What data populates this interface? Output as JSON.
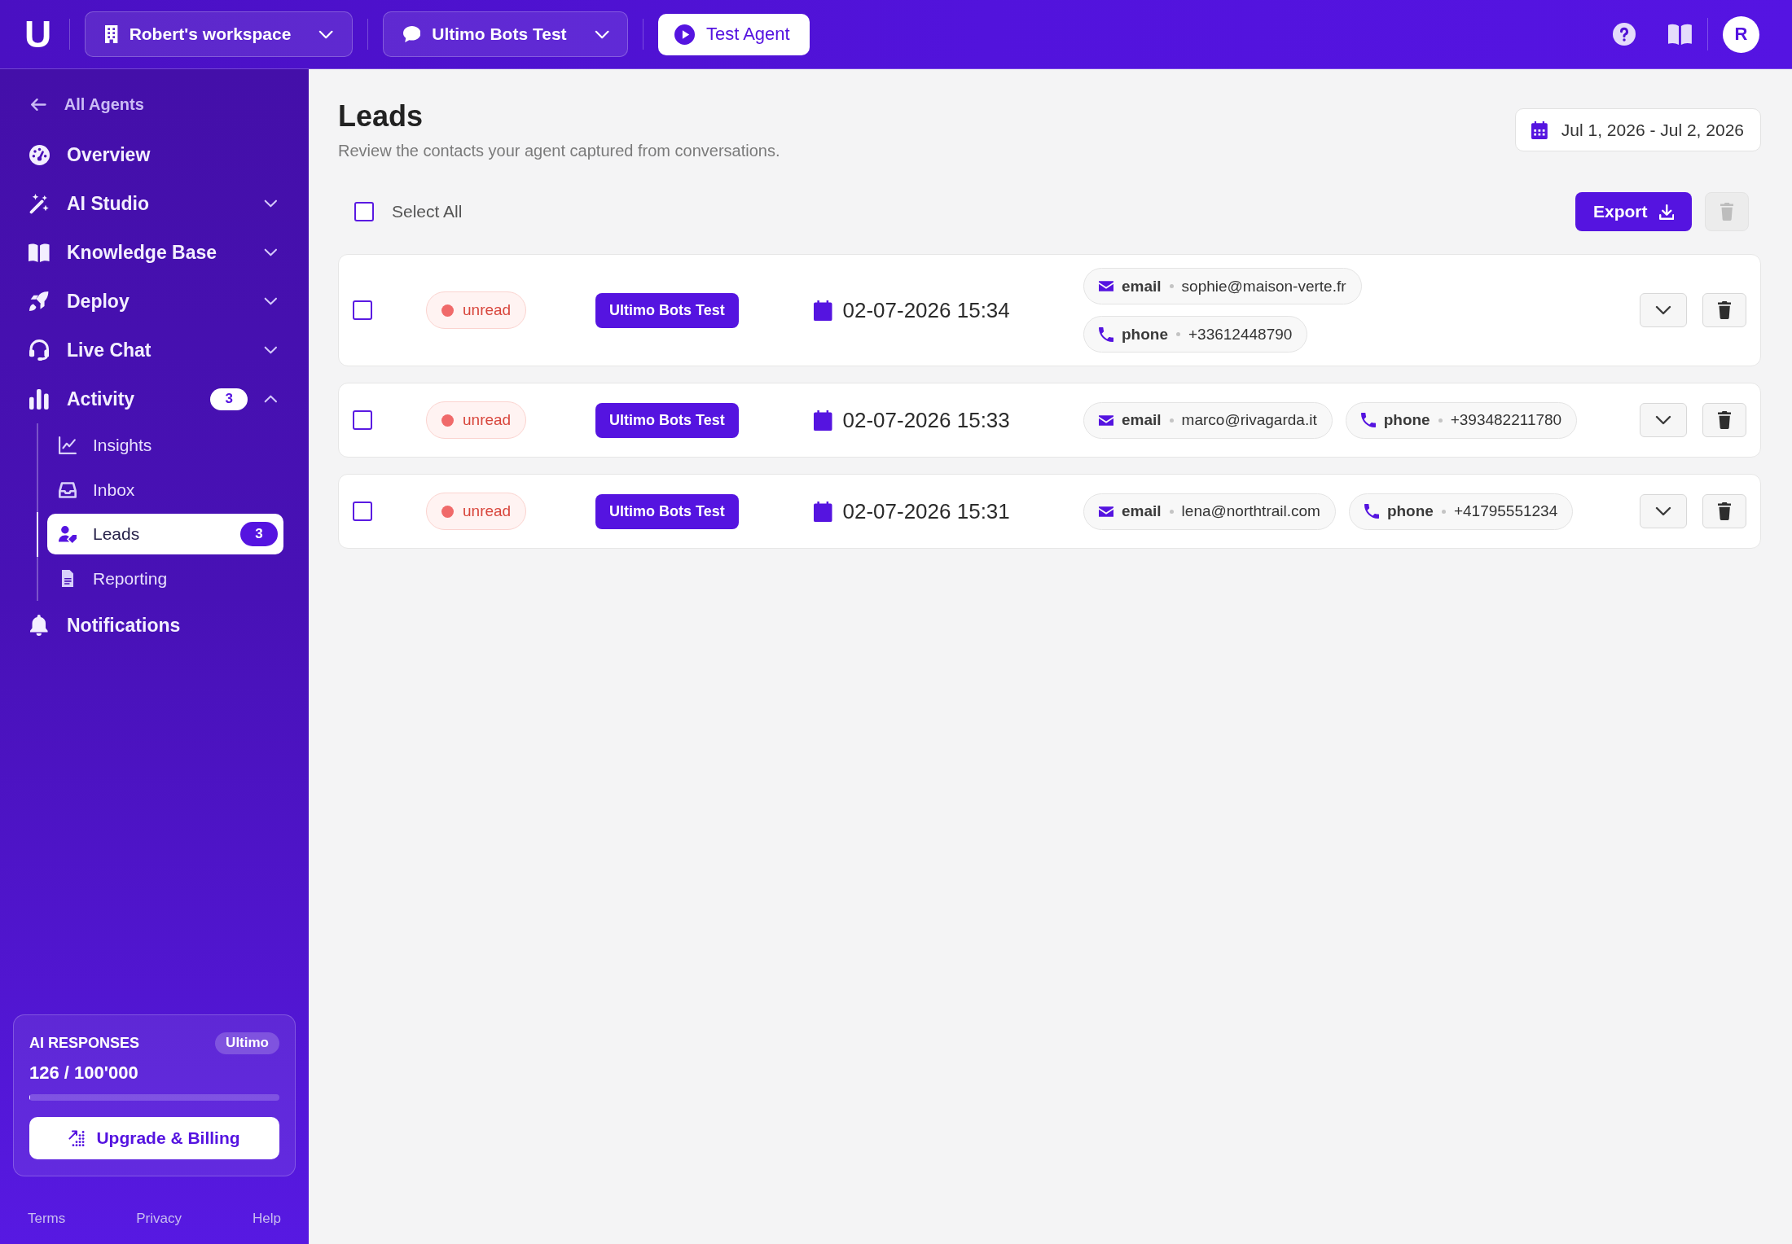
{
  "top_bar": {
    "logo": "U",
    "workspace": "Robert's workspace",
    "agent": "Ultimo Bots Test",
    "test_button": "Test Agent",
    "avatar": "R"
  },
  "sidebar": {
    "back_link": "All Agents",
    "items": [
      {
        "label": "Overview",
        "kind": "link",
        "selected": false
      },
      {
        "label": "AI Studio",
        "kind": "group",
        "expanded": false,
        "selected": false
      },
      {
        "label": "Knowledge Base",
        "kind": "group",
        "expanded": false,
        "selected": false
      },
      {
        "label": "Deploy",
        "kind": "group",
        "expanded": false,
        "selected": false
      },
      {
        "label": "Live Chat",
        "kind": "group",
        "expanded": false,
        "selected": false
      },
      {
        "label": "Activity",
        "kind": "group",
        "expanded": true,
        "selected": false,
        "badge": "3",
        "children": [
          {
            "label": "Insights",
            "selected": false
          },
          {
            "label": "Inbox",
            "selected": false
          },
          {
            "label": "Leads",
            "selected": true,
            "badge": "3"
          },
          {
            "label": "Reporting",
            "selected": false
          }
        ]
      },
      {
        "label": "Notifications",
        "kind": "link",
        "selected": false
      }
    ],
    "usage_card": {
      "title": "AI RESPONSES",
      "plan": "Ultimo",
      "count": "126 / 100'000",
      "level": 0.00126,
      "button": "Upgrade & Billing"
    },
    "footer_links": [
      "Terms",
      "Privacy",
      "Help"
    ]
  },
  "page": {
    "title": "Leads",
    "subtitle": "Review the contacts your agent captured from conversations.",
    "date_range": "Jul 1, 2026 - Jul 2, 2026"
  },
  "toolbar": {
    "select_all": {
      "label": "Select All",
      "checked": false
    },
    "export_button": "Export",
    "delete_button": {
      "disabled": true
    }
  },
  "leads": [
    {
      "checked": false,
      "status": "unread",
      "agent": "Ultimo Bots Test",
      "datetime": "02-07-2026 15:34",
      "expanded": false,
      "contacts": [
        {
          "kind": "email",
          "label": "email",
          "value": "sophie@maison-verte.fr"
        },
        {
          "kind": "phone",
          "label": "phone",
          "value": "+33612448790"
        }
      ]
    },
    {
      "checked": false,
      "status": "unread",
      "agent": "Ultimo Bots Test",
      "datetime": "02-07-2026 15:33",
      "expanded": false,
      "contacts": [
        {
          "kind": "email",
          "label": "email",
          "value": "marco@rivagarda.it"
        },
        {
          "kind": "phone",
          "label": "phone",
          "value": "+393482211780"
        }
      ]
    },
    {
      "checked": false,
      "status": "unread",
      "agent": "Ultimo Bots Test",
      "datetime": "02-07-2026 15:31",
      "expanded": false,
      "contacts": [
        {
          "kind": "email",
          "label": "email",
          "value": "lena@northtrail.com"
        },
        {
          "kind": "phone",
          "label": "phone",
          "value": "+41795551234"
        }
      ]
    }
  ]
}
